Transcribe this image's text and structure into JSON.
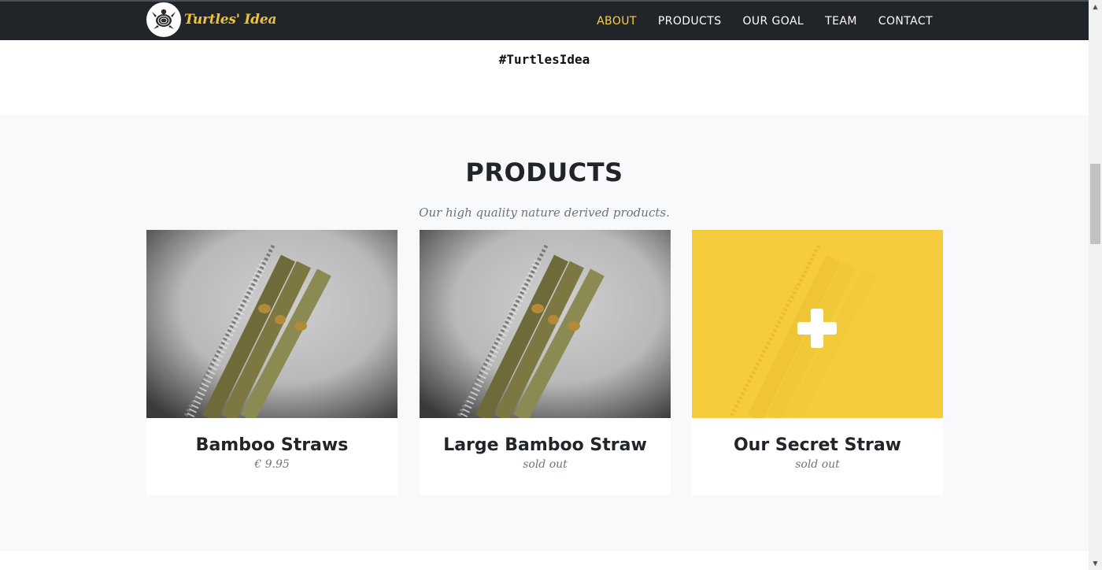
{
  "brand": {
    "name": "Turtles' Idea",
    "logo_icon": "turtle-icon"
  },
  "nav": {
    "items": [
      {
        "label": "ABOUT",
        "active": true
      },
      {
        "label": "PRODUCTS",
        "active": false
      },
      {
        "label": "OUR GOAL",
        "active": false
      },
      {
        "label": "TEAM",
        "active": false
      },
      {
        "label": "CONTACT",
        "active": false
      }
    ]
  },
  "hashtag": "#TurtlesIdea",
  "products": {
    "heading": "PRODUCTS",
    "subheading": "Our high quality nature derived products.",
    "items": [
      {
        "title": "Bamboo Straws",
        "meta": "€ 9.95",
        "image": "bamboo-straws-image"
      },
      {
        "title": "Large Bamboo Straw",
        "meta": "sold out",
        "image": "large-bamboo-straw-image"
      },
      {
        "title": "Our Secret Straw",
        "meta": "sold out",
        "image": "secret-straw-image",
        "overlay_icon": "plus-icon"
      }
    ]
  },
  "colors": {
    "navbar": "#212529",
    "accent": "#fed136",
    "section_bg": "#f8f9fa",
    "secret_card_bg": "#f5cc3e"
  }
}
